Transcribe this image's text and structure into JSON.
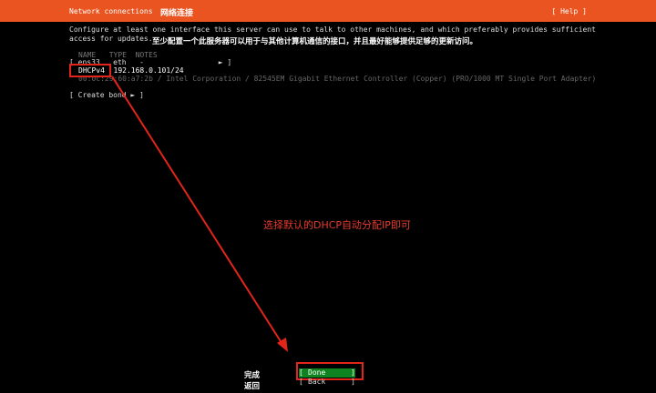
{
  "header": {
    "title": "Network connections",
    "title_cn": "网络连接",
    "help": "[ Help ]"
  },
  "description": {
    "line1": "Configure at least one interface this server can use to talk to other machines, and which preferably provides sufficient",
    "line2": "access for updates.",
    "cn": "至少配置一个此服务器可以用于与其他计算机通信的接口，并且最好能够提供足够的更新访问。"
  },
  "table": {
    "header": "NAME   TYPE  NOTES",
    "interface_row": "[ ens33   eth   -                 ► ]",
    "dhcp_row": "DHCPv4  192.168.0.101/24",
    "mac_row": "00:0c:29:60:a7:2b / Intel Corporation / 82545EM Gigabit Ethernet Controller (Copper) (PRO/1000 MT Single Port Adapter)"
  },
  "create_bond": "[ Create bond ► ]",
  "annotation": "选择默认的DHCP自动分配IP即可",
  "buttons": {
    "done": "Done",
    "back": "Back",
    "done_cn": "完成",
    "back_cn": "返回",
    "left_bracket": "[",
    "right_bracket": "]"
  },
  "colors": {
    "header_bg": "#e95420",
    "done_bg": "#0e8420",
    "annotation_red": "#e1251b"
  }
}
